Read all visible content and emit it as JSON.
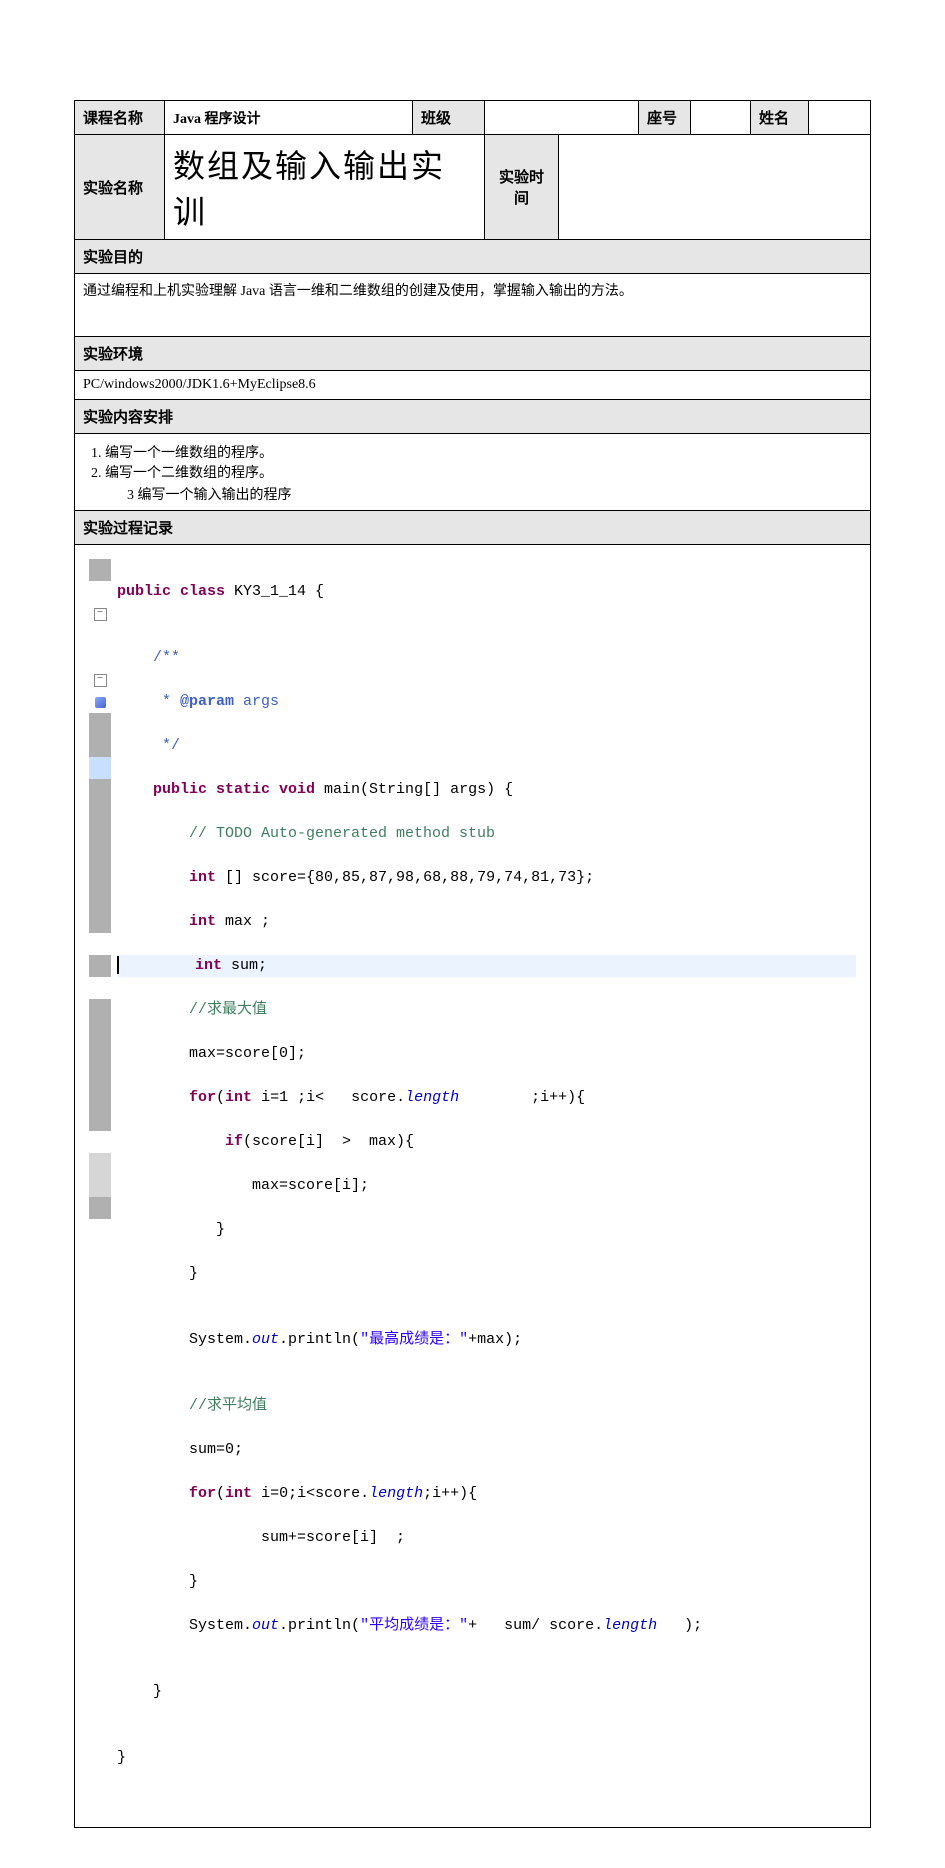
{
  "row1": {
    "courseNameLabel": "课程名称",
    "courseNameValue": "Java 程序设计",
    "classLabel": "班级",
    "classValue": "",
    "seatLabel": "座号",
    "seatValue": "",
    "nameLabel": "姓名",
    "nameValue": ""
  },
  "row2": {
    "expNameLabel": "实验名称",
    "expNameValue": "数组及输入输出实训",
    "expTimeLabel": "实验时间",
    "expTimeValue": ""
  },
  "secGoal": {
    "header": "实验目的",
    "text": "通过编程和上机实验理解 Java 语言一维和二维数组的创建及使用，掌握输入输出的方法。"
  },
  "secEnv": {
    "header": "实验环境",
    "text": "PC/windows2000/JDK1.6+MyEclipse8.6"
  },
  "secContent": {
    "header": "实验内容安排",
    "item1": "编写一个一维数组的程序。",
    "item2": "编写一个二维数组的程序。",
    "item3": "3 编写一个输入输出的程序"
  },
  "secProcess": {
    "header": "实验过程记录"
  },
  "code": {
    "l01a": "public",
    "l01b": " class",
    "l01c": " KY3_1_14 {",
    "l02": "",
    "l03": "    /**",
    "l04": "     * @param args",
    "l05": "     */",
    "l06a": "    public",
    "l06b": " static",
    "l06c": " void",
    "l06d": " main(String[] args) {",
    "l07": "        // TODO Auto-generated method stub",
    "l08a": "        int",
    "l08b": " [] score={80,85,87,98,68,88,79,74,81,73};",
    "l09a": "        int",
    "l09b": " max ;",
    "l10a": "        int",
    "l10b": " sum;",
    "l11": "        //求最大值",
    "l12": "        max=score[0];",
    "l13a": "        for",
    "l13b": "(",
    "l13c": "int",
    "l13d": " i=1 ;i<   score.",
    "l13e": "length",
    "l13f": "        ;i++){",
    "l14a": "            if",
    "l14b": "(score[i]  >  max){",
    "l15": "               max=score[i];",
    "l16": "           }",
    "l17": "        }",
    "l18": "",
    "l19a": "        System.",
    "l19b": "out",
    "l19c": ".println(",
    "l19d": "\"最高成绩是：\"",
    "l19e": "+max);",
    "l20": "",
    "l21": "        //求平均值",
    "l22": "        sum=0;",
    "l23a": "        for",
    "l23b": "(",
    "l23c": "int",
    "l23d": " i=0;i<score.",
    "l23e": "length",
    "l23f": ";i++){",
    "l24": "                sum+=score[i]  ;",
    "l25": "        }",
    "l26a": "        System.",
    "l26b": "out",
    "l26c": ".println(",
    "l26d": "\"平均成绩是：\"",
    "l26e": "+   sum/ score.",
    "l26f": "length",
    "l26g": "   );",
    "l27": "",
    "l28": "    }",
    "l29": "",
    "l30": "}"
  }
}
